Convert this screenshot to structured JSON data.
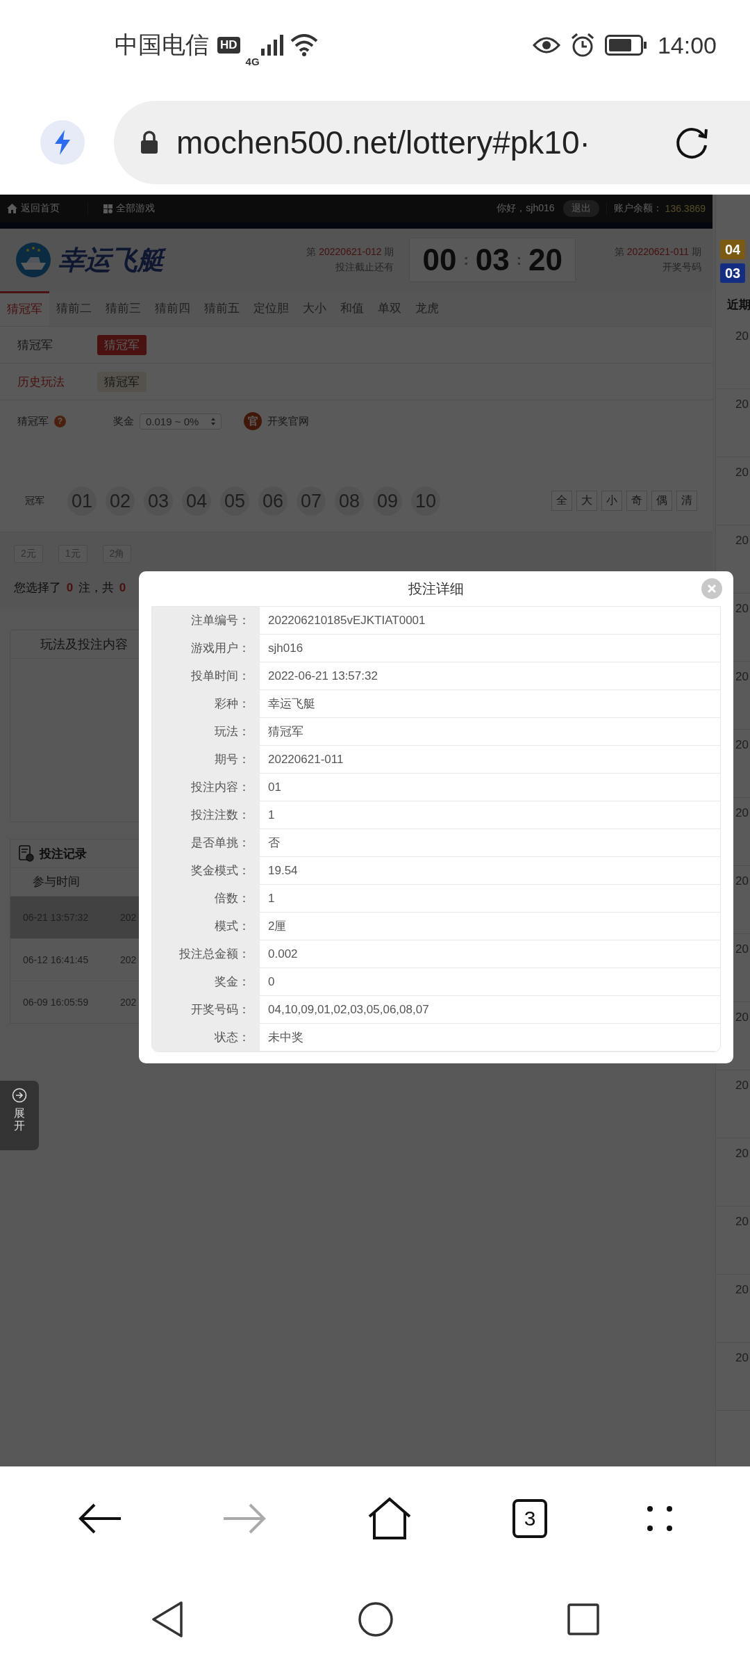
{
  "status_bar": {
    "carrier": "中国电信",
    "network_badge": "HD",
    "network": "4G",
    "time": "14:00"
  },
  "browser": {
    "url": "mochen500.net/lottery#pk10·",
    "tab_count": "3"
  },
  "top_nav": {
    "home_link": "返回首页",
    "games_link": "全部游戏",
    "greeting": "你好，sjh016",
    "logout": "退出",
    "balance_label": "账户余额：",
    "balance": "136.3869"
  },
  "header": {
    "logo_text": "幸运飞艇",
    "current_issue": {
      "prefix": "第",
      "issue": "20220621-012",
      "suffix": "期",
      "caption": "投注截止还有"
    },
    "countdown": [
      "00",
      "03",
      "20"
    ],
    "countdown_separator": ":",
    "last_issue": {
      "prefix": "第",
      "issue": "20220621-011",
      "suffix": "期",
      "caption": "开奖号码"
    },
    "draw_balls": [
      {
        "number": "04",
        "color": "#7d5a12"
      },
      {
        "number": "03",
        "color": "#132d82"
      }
    ]
  },
  "tabs": [
    {
      "label": "猜冠军",
      "selected": true
    },
    {
      "label": "猜前二",
      "selected": false
    },
    {
      "label": "猜前三",
      "selected": false
    },
    {
      "label": "猜前四",
      "selected": false
    },
    {
      "label": "猜前五",
      "selected": false
    },
    {
      "label": "定位胆",
      "selected": false
    },
    {
      "label": "大小",
      "selected": false
    },
    {
      "label": "和值",
      "selected": false
    },
    {
      "label": "单双",
      "selected": false
    },
    {
      "label": "龙虎",
      "selected": false
    }
  ],
  "play_row": {
    "label": "猜冠军",
    "options": [
      {
        "label": "猜冠军",
        "selected": true
      }
    ]
  },
  "history_row": {
    "label": "历史玩法",
    "items": [
      "猜冠军"
    ]
  },
  "bet_options": {
    "play": "猜冠军",
    "help": "?",
    "prize_label": "奖金",
    "prize_value": "0.019 ~ 0%",
    "official_icon": "官",
    "official_link": "开奖官网"
  },
  "number_row": {
    "label": "冠军",
    "numbers": [
      {
        "label": "01",
        "selected": false
      },
      {
        "label": "02",
        "selected": false
      },
      {
        "label": "03",
        "selected": false
      },
      {
        "label": "04",
        "selected": false
      },
      {
        "label": "05",
        "selected": false
      },
      {
        "label": "06",
        "selected": false
      },
      {
        "label": "07",
        "selected": false
      },
      {
        "label": "08",
        "selected": false
      },
      {
        "label": "09",
        "selected": false
      },
      {
        "label": "10",
        "selected": false
      }
    ],
    "quick_buttons": [
      "全",
      "大",
      "小",
      "奇",
      "偶",
      "清"
    ]
  },
  "units": [
    "2元",
    "1元",
    "2角"
  ],
  "summary": {
    "prefix": "您选择了",
    "count": "0",
    "middle": "注，共",
    "amount": "0"
  },
  "bet_content_panel": {
    "title": "玩法及投注内容"
  },
  "records": {
    "title": "投注记录",
    "columns": [
      "参与时间"
    ],
    "rows": [
      {
        "time": "06-21 13:57:32",
        "column_2": "202",
        "selected": true
      },
      {
        "time": "06-12 16:41:45",
        "column_2": "202",
        "selected": false
      },
      {
        "time": "06-09 16:05:59",
        "column_2": "202",
        "selected": false
      }
    ]
  },
  "expand_tab": {
    "label": "展开"
  },
  "side_panel": {
    "title": "近期",
    "rows": [
      "20",
      "20",
      "20",
      "20",
      "20",
      "20",
      "20",
      "20",
      "20",
      "20",
      "20",
      "20",
      "20",
      "20",
      "20",
      "20"
    ]
  },
  "modal": {
    "title": "投注详细",
    "rows": [
      {
        "label": "注单编号：",
        "value": "202206210185vEJKTIAT0001"
      },
      {
        "label": "游戏用户：",
        "value": "sjh016"
      },
      {
        "label": "投单时间：",
        "value": "2022-06-21 13:57:32"
      },
      {
        "label": "彩种：",
        "value": "幸运飞艇"
      },
      {
        "label": "玩法：",
        "value": "猜冠军"
      },
      {
        "label": "期号：",
        "value": "20220621-011"
      },
      {
        "label": "投注内容：",
        "value": "01"
      },
      {
        "label": "投注注数：",
        "value": "1"
      },
      {
        "label": "是否单挑：",
        "value": "否"
      },
      {
        "label": "奖金模式：",
        "value": "19.54"
      },
      {
        "label": "倍数：",
        "value": "1"
      },
      {
        "label": "模式：",
        "value": "2厘"
      },
      {
        "label": "投注总金额：",
        "value": "0.002"
      },
      {
        "label": "奖金：",
        "value": "0"
      },
      {
        "label": "开奖号码：",
        "value": "04,10,09,01,02,03,05,06,08,07"
      },
      {
        "label": "状态：",
        "value": "未中奖"
      }
    ]
  }
}
